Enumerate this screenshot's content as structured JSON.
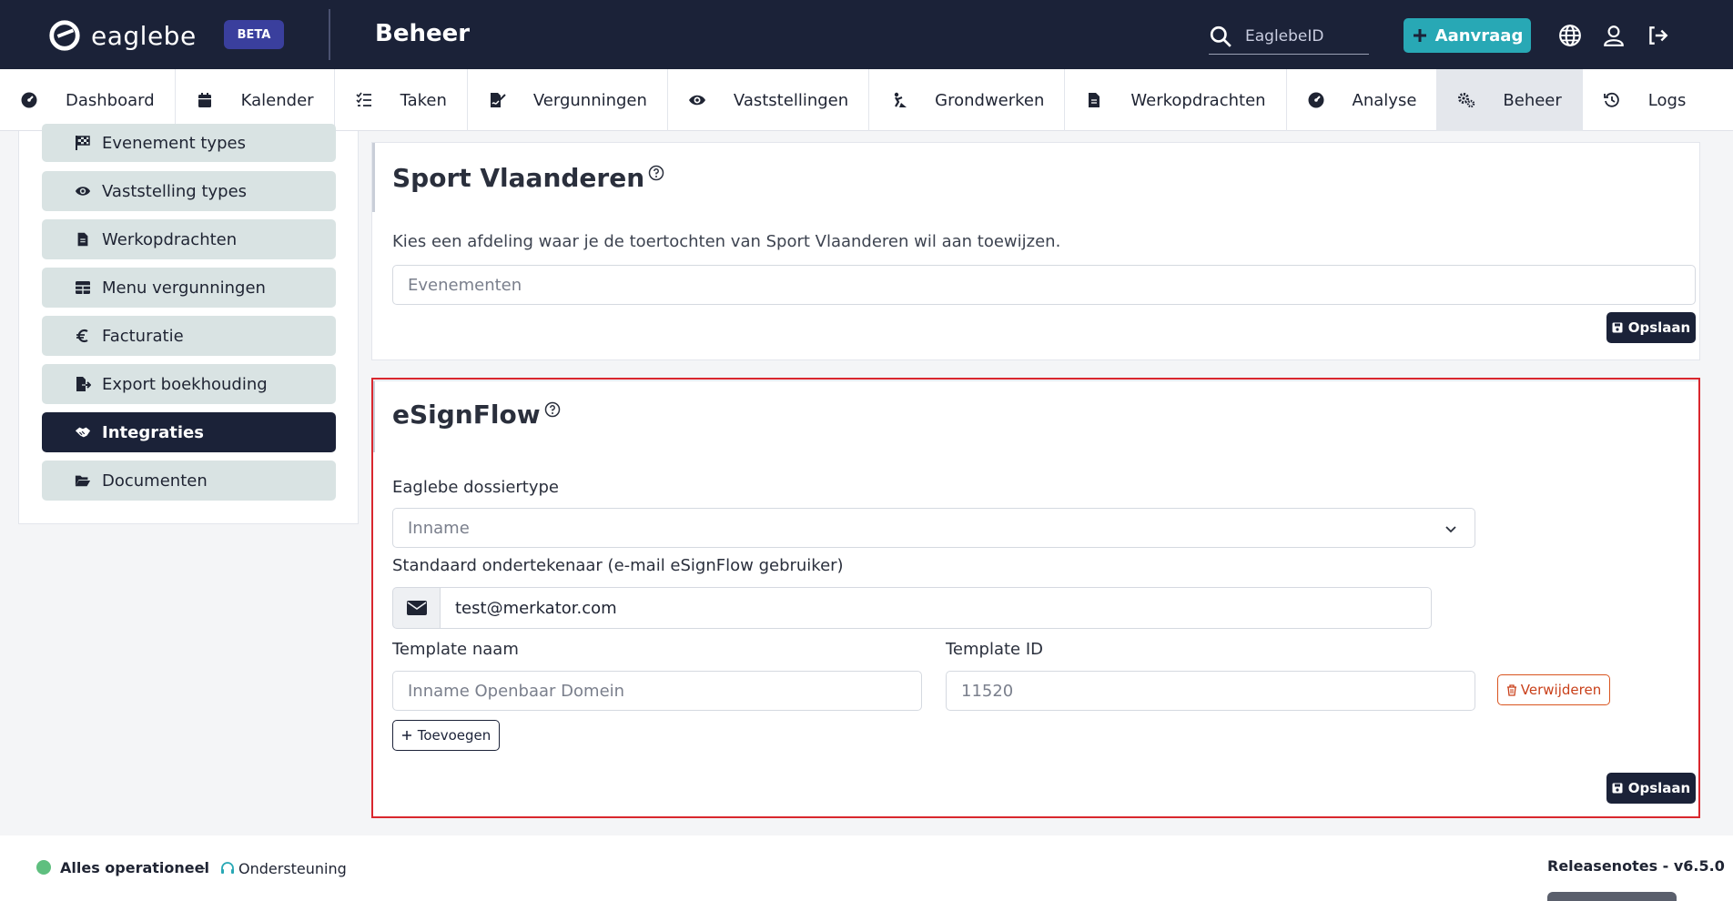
{
  "header": {
    "logo_text": "eaglebe",
    "beta_badge": "BETA",
    "page_title": "Beheer",
    "search_placeholder": "EaglebeID",
    "aanvraag_label": "Aanvraag"
  },
  "nav": {
    "tabs": [
      {
        "label": "Dashboard",
        "icon": "gauge-icon"
      },
      {
        "label": "Kalender",
        "icon": "calendar-icon"
      },
      {
        "label": "Taken",
        "icon": "tasks-icon"
      },
      {
        "label": "Vergunningen",
        "icon": "file-signature-icon"
      },
      {
        "label": "Vaststellingen",
        "icon": "eye-icon"
      },
      {
        "label": "Grondwerken",
        "icon": "digging-icon"
      },
      {
        "label": "Werkopdrachten",
        "icon": "file-icon"
      },
      {
        "label": "Analyse",
        "icon": "gauge-icon"
      },
      {
        "label": "Beheer",
        "icon": "cogs-icon",
        "active": true
      },
      {
        "label": "Logs",
        "icon": "history-icon"
      }
    ]
  },
  "sidebar": {
    "items": [
      {
        "label": "Evenement types",
        "icon": "flag-checkered-icon"
      },
      {
        "label": "Vaststelling types",
        "icon": "eye-icon"
      },
      {
        "label": "Werkopdrachten",
        "icon": "file-icon"
      },
      {
        "label": "Menu vergunningen",
        "icon": "table-icon"
      },
      {
        "label": "Facturatie",
        "icon": "euro-icon"
      },
      {
        "label": "Export boekhouding",
        "icon": "file-export-icon"
      },
      {
        "label": "Integraties",
        "icon": "handshake-icon",
        "active": true
      },
      {
        "label": "Documenten",
        "icon": "folder-open-icon"
      }
    ]
  },
  "sport": {
    "title": "Sport Vlaanderen",
    "description": "Kies een afdeling waar je de toertochten van Sport Vlaanderen wil aan toewijzen.",
    "afdeling_placeholder": "Evenementen",
    "save_label": "Opslaan"
  },
  "esign": {
    "title": "eSignFlow",
    "dossiertype_label": "Eaglebe dossiertype",
    "dossiertype_value": "Inname",
    "signer_label": "Standaard ondertekenaar (e-mail eSignFlow gebruiker)",
    "signer_value": "test@merkator.com",
    "template_name_label": "Template naam",
    "template_id_label": "Template ID",
    "template_name_placeholder": "Inname Openbaar Domein",
    "template_id_placeholder": "11520",
    "delete_label": "Verwijderen",
    "add_label": "Toevoegen",
    "save_label": "Opslaan"
  },
  "footer": {
    "status": "Alles operationeel",
    "separator": "-",
    "support": "Ondersteuning",
    "release": "Releasenotes - v6.5.0"
  },
  "colors": {
    "header_bg": "#1b2238",
    "accent": "#28a8b5",
    "beta_bg": "#3a3f9d",
    "sidebar_item_bg": "#d9e3e3",
    "danger": "#d9541f",
    "status_ok": "#5fbf7f",
    "highlight_outline": "#d9272e"
  }
}
